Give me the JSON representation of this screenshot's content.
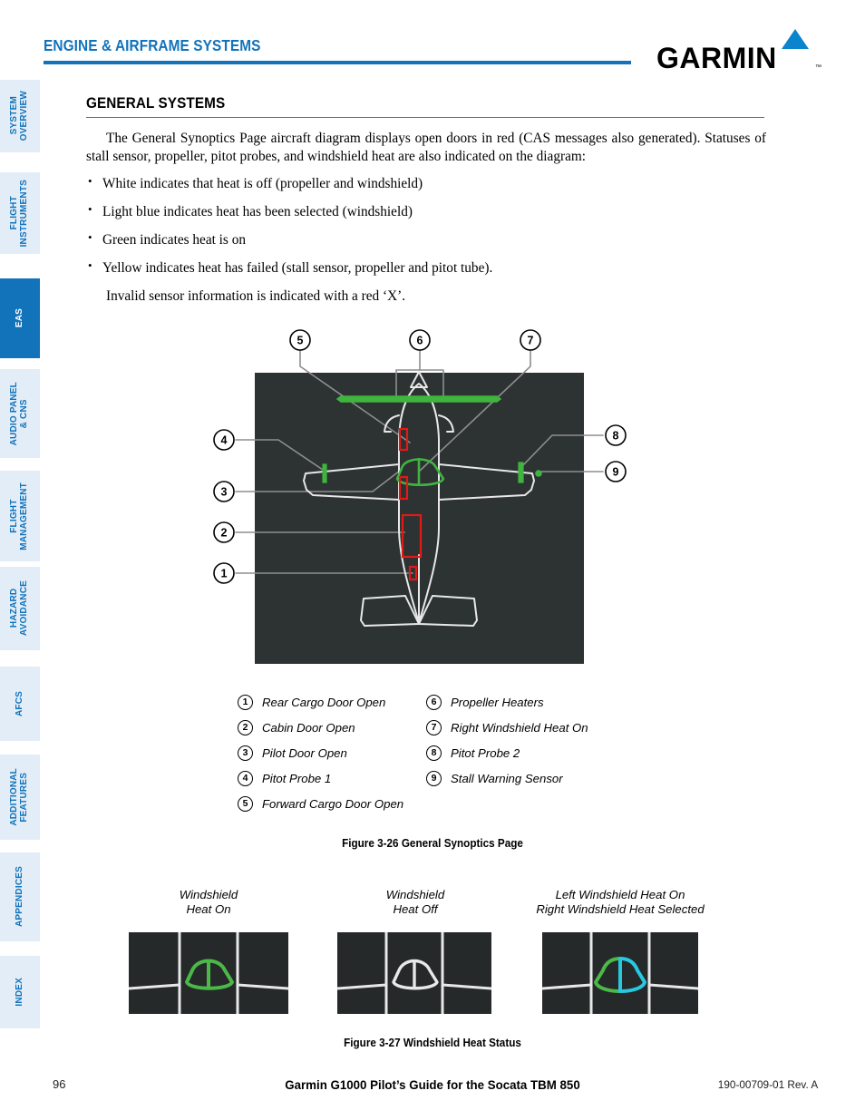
{
  "header": {
    "title": "ENGINE & AIRFRAME SYSTEMS",
    "brand": "GARMIN",
    "brand_tm": "™",
    "accent_color": "#1273bb"
  },
  "sidebar": {
    "items": [
      {
        "label": "SYSTEM\nOVERVIEW",
        "active": false
      },
      {
        "label": "FLIGHT\nINSTRUMENTS",
        "active": false
      },
      {
        "label": "EAS",
        "active": true
      },
      {
        "label": "AUDIO PANEL\n& CNS",
        "active": false
      },
      {
        "label": "FLIGHT\nMANAGEMENT",
        "active": false
      },
      {
        "label": "HAZARD\nAVOIDANCE",
        "active": false
      },
      {
        "label": "AFCS",
        "active": false
      },
      {
        "label": "ADDITIONAL\nFEATURES",
        "active": false
      },
      {
        "label": "APPENDICES",
        "active": false
      },
      {
        "label": "INDEX",
        "active": false
      }
    ]
  },
  "main": {
    "section_heading": "GENERAL SYSTEMS",
    "intro": "The General Synoptics Page aircraft diagram displays open doors in red (CAS messages also generated). Statuses of stall sensor, propeller, pitot probes, and windshield heat are also indicated on the diagram:",
    "bullets": [
      "White indicates that heat is off (propeller and windshield)",
      "Light blue indicates heat has been selected (windshield)",
      "Green indicates heat is on",
      "Yellow indicates heat has failed (stall sensor, propeller and pitot tube)."
    ],
    "note": "Invalid sensor information is indicated with a red ‘X’."
  },
  "figure26": {
    "caption": "Figure 3-26  General Synoptics Page",
    "panel_bg": "#2d3233",
    "callout_numbers": [
      "1",
      "2",
      "3",
      "4",
      "5",
      "6",
      "7",
      "8",
      "9"
    ],
    "legend_left": [
      {
        "num": "1",
        "label": "Rear Cargo Door Open"
      },
      {
        "num": "2",
        "label": "Cabin Door Open"
      },
      {
        "num": "3",
        "label": "Pilot Door Open"
      },
      {
        "num": "4",
        "label": "Pitot Probe 1"
      },
      {
        "num": "5",
        "label": "Forward Cargo Door Open"
      }
    ],
    "legend_right": [
      {
        "num": "6",
        "label": "Propeller Heaters"
      },
      {
        "num": "7",
        "label": "Right Windshield Heat On"
      },
      {
        "num": "8",
        "label": "Pitot Probe 2"
      },
      {
        "num": "9",
        "label": "Stall Warning Sensor"
      }
    ],
    "colors": {
      "door_open_red": "#e01b16",
      "heat_on_green": "#3fb53f",
      "airframe_white": "#e8e8e8",
      "callout_line": "#8e8e8e"
    }
  },
  "figure27": {
    "caption": "Figure 3-27  Windshield Heat Status",
    "panels": [
      {
        "caption": "Windshield\nHeat On",
        "left_color": "#4cb848",
        "right_color": "#4cb848"
      },
      {
        "caption": "Windshield\nHeat Off",
        "left_color": "#e8e8e8",
        "right_color": "#e8e8e8"
      },
      {
        "caption": "Left Windshield Heat On\nRight Windshield Heat Selected",
        "left_color": "#4cb848",
        "right_color": "#28c8e0"
      }
    ]
  },
  "footer": {
    "page_number": "96",
    "center": "Garmin G1000 Pilot’s Guide for the Socata TBM 850",
    "right": "190-00709-01  Rev. A"
  }
}
